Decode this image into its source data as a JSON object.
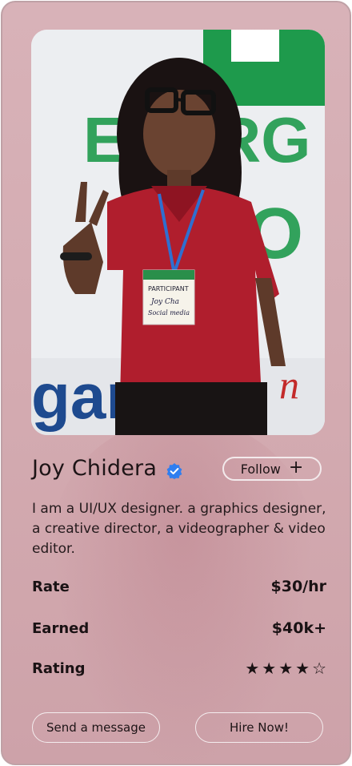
{
  "profile": {
    "name": "Joy Chidera",
    "verified": true,
    "follow_label": "Follow",
    "follow_icon": "plus-icon",
    "bio": "I am a UI/UX designer. a graphics designer, a creative director, a videographer & video editor.",
    "photo_badge_lines": [
      "PARTICIPANT",
      "Joy Cha",
      "Social media"
    ]
  },
  "stats": [
    {
      "label": "Rate",
      "value": "$30/hr"
    },
    {
      "label": "Earned",
      "value": "$40k+"
    },
    {
      "label": "Rating",
      "stars_filled": 4,
      "stars_total": 5
    }
  ],
  "actions": {
    "message_label": "Send a message",
    "hire_label": "Hire Now!"
  },
  "colors": {
    "card_bg": "#d6adb4",
    "accent_red": "#b01e2d",
    "verified_blue": "#2f7ef0",
    "banner_green": "#1e9a4c",
    "banner_blue": "#1e4a8f"
  }
}
